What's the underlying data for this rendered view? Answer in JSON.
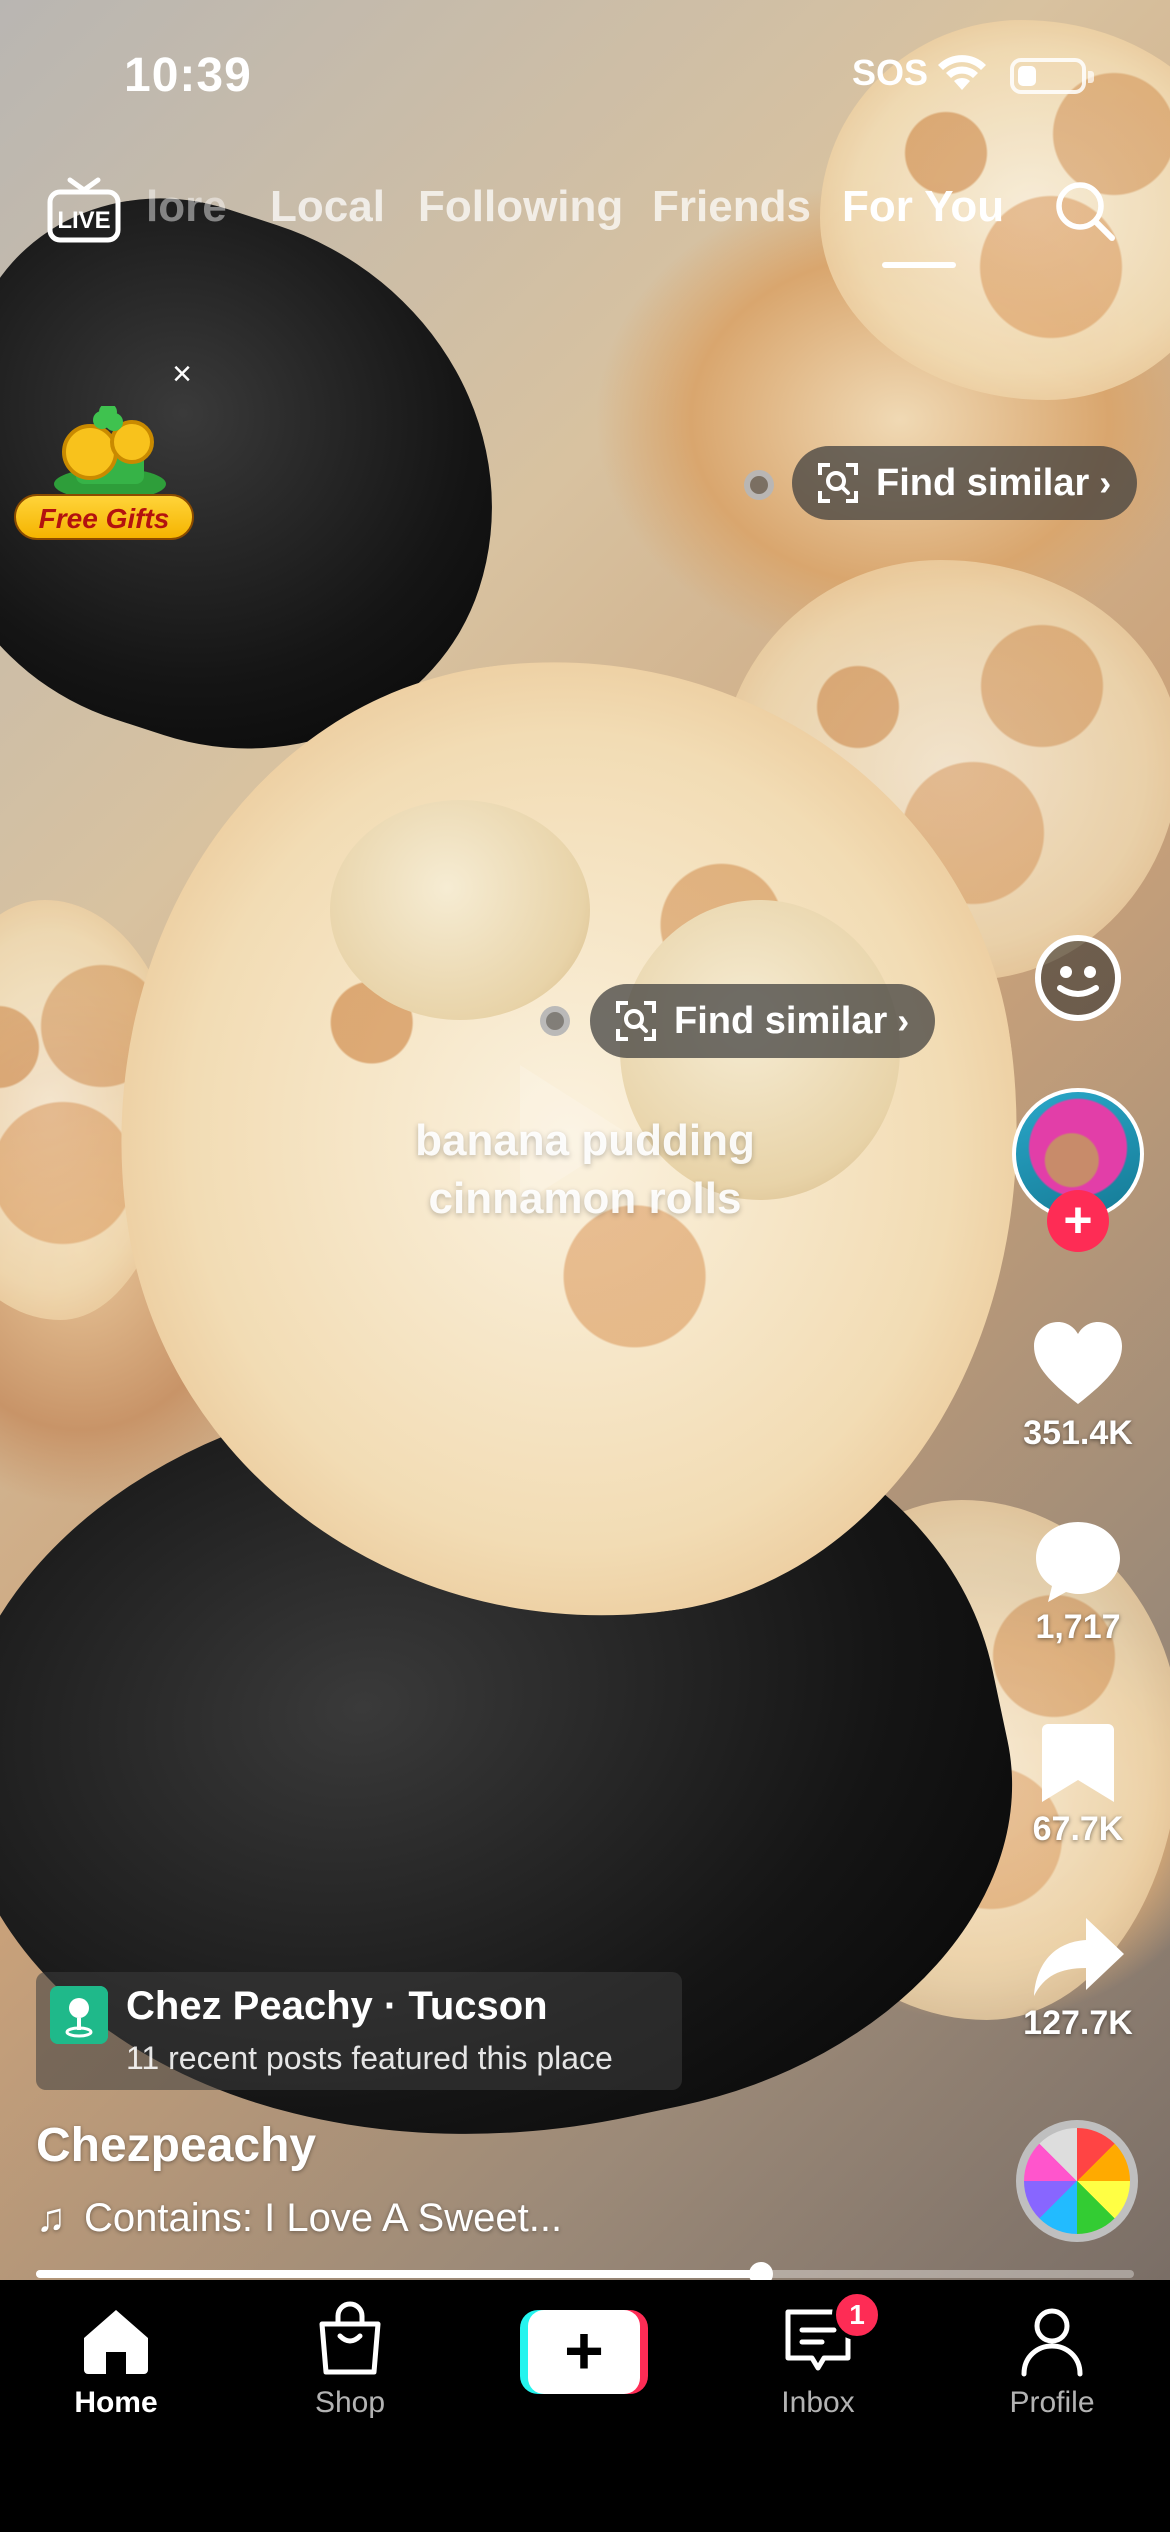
{
  "status_bar": {
    "time": "10:39",
    "carrier": "SOS",
    "battery_level": 0.3
  },
  "top_nav": {
    "tabs": [
      "lore",
      "Local",
      "Following",
      "Friends",
      "For You"
    ],
    "active_tab": "For You",
    "live_label": "LIVE"
  },
  "promo": {
    "label": "Free Gifts"
  },
  "find_similar": {
    "label": "Find similar"
  },
  "video": {
    "caption_line1": "banana pudding",
    "caption_line2": "cinnamon rolls"
  },
  "actions": {
    "likes": "351.4K",
    "comments": "1,717",
    "saves": "67.7K",
    "shares": "127.7K"
  },
  "location": {
    "name": "Chez Peachy",
    "separator": "·",
    "city": "Tucson",
    "subtitle": "11 recent posts featured this place"
  },
  "author": {
    "username": "Chezpeachy"
  },
  "sound": {
    "label": "Contains: I Love A Sweet..."
  },
  "progress": {
    "fraction": 0.66
  },
  "bottom_nav": {
    "home": "Home",
    "shop": "Shop",
    "inbox": "Inbox",
    "profile": "Profile",
    "inbox_badge": "1",
    "create_symbol": "+"
  },
  "colors": {
    "accent_red": "#fe2c55",
    "accent_cyan": "#25f4ee",
    "location_green": "#1fb98a"
  }
}
